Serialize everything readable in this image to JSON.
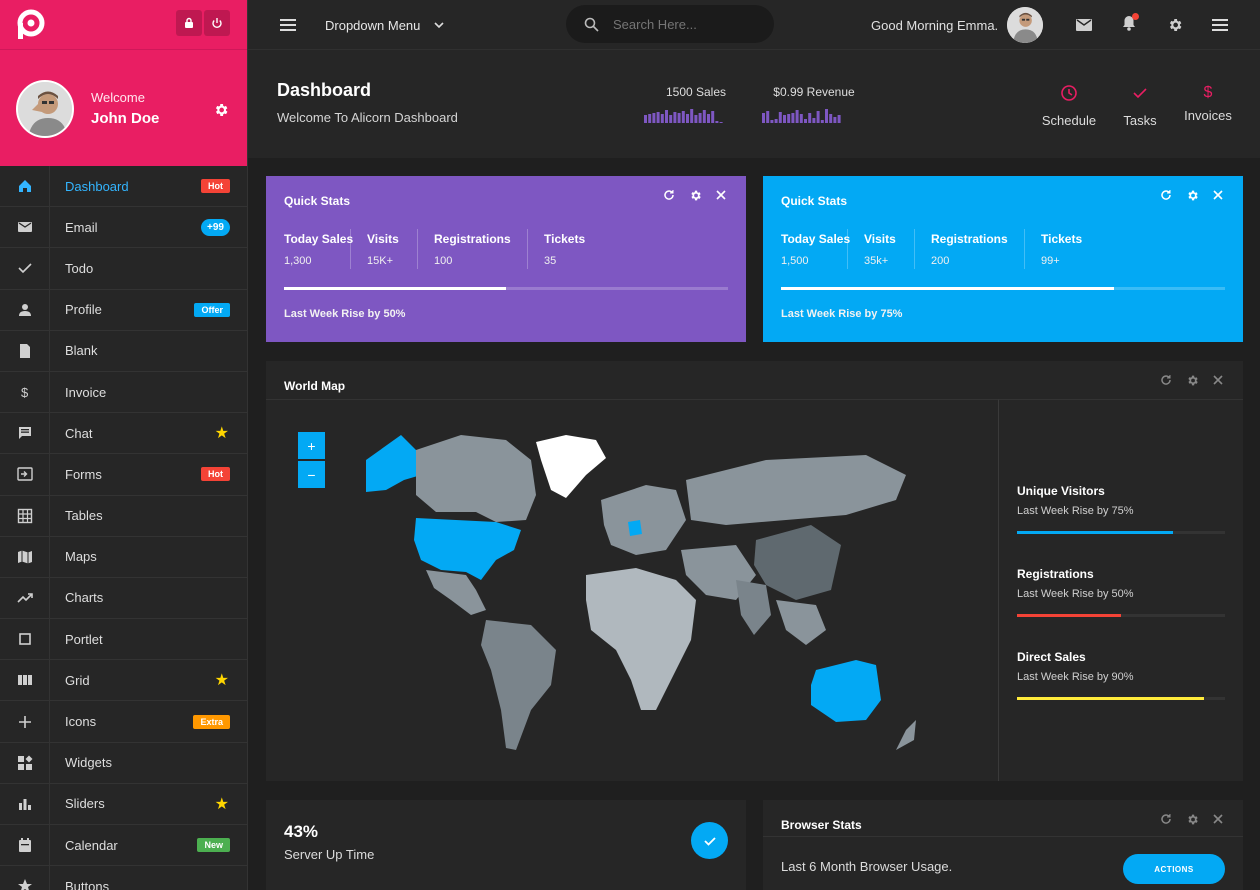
{
  "sidebar": {
    "user": {
      "welcome": "Welcome",
      "name": "John Doe"
    },
    "items": [
      {
        "label": "Dashboard",
        "icon": "home-icon",
        "badge": "Hot",
        "badge_type": "hot",
        "active": true
      },
      {
        "label": "Email",
        "icon": "mail-icon",
        "badge": "+99",
        "badge_type": "num"
      },
      {
        "label": "Todo",
        "icon": "check-icon"
      },
      {
        "label": "Profile",
        "icon": "person-icon",
        "badge": "Offer",
        "badge_type": "offer"
      },
      {
        "label": "Blank",
        "icon": "file-icon"
      },
      {
        "label": "Invoice",
        "icon": "dollar-icon"
      },
      {
        "label": "Chat",
        "icon": "chat-icon",
        "star": true
      },
      {
        "label": "Forms",
        "icon": "input-icon",
        "badge": "Hot",
        "badge_type": "hot"
      },
      {
        "label": "Tables",
        "icon": "grid-icon"
      },
      {
        "label": "Maps",
        "icon": "map-icon"
      },
      {
        "label": "Charts",
        "icon": "trending-icon"
      },
      {
        "label": "Portlet",
        "icon": "square-icon"
      },
      {
        "label": "Grid",
        "icon": "columns-icon",
        "star": true
      },
      {
        "label": "Icons",
        "icon": "plus-icon",
        "badge": "Extra",
        "badge_type": "extra"
      },
      {
        "label": "Widgets",
        "icon": "widgets-icon"
      },
      {
        "label": "Sliders",
        "icon": "bar-chart-icon",
        "star": true
      },
      {
        "label": "Calendar",
        "icon": "calendar-icon",
        "badge": "New",
        "badge_type": "new"
      },
      {
        "label": "Buttons",
        "icon": "star-icon"
      }
    ]
  },
  "topbar": {
    "dropdown_label": "Dropdown Menu",
    "search_placeholder": "Search Here...",
    "greeting": "Good Morning Emma."
  },
  "header": {
    "title": "Dashboard",
    "subtitle": "Welcome To Alicorn Dashboard",
    "sales_label": "1500 Sales",
    "revenue_label": "$0.99 Revenue",
    "actions": [
      {
        "label": "Schedule",
        "icon": "clock-icon"
      },
      {
        "label": "Tasks",
        "icon": "check-icon"
      },
      {
        "label": "Invoices",
        "icon": "dollar-icon"
      }
    ]
  },
  "quick_stats": [
    {
      "title": "Quick Stats",
      "color": "#7e57c2",
      "footer": "Last Week Rise by 50%",
      "progress": 0.5,
      "stats": [
        {
          "k": "Today Sales",
          "v": "1,300"
        },
        {
          "k": "Visits",
          "v": "15K+"
        },
        {
          "k": "Registrations",
          "v": "100"
        },
        {
          "k": "Tickets",
          "v": "35"
        }
      ]
    },
    {
      "title": "Quick Stats",
      "color": "#03a9f4",
      "footer": "Last Week Rise by 75%",
      "progress": 0.75,
      "stats": [
        {
          "k": "Today Sales",
          "v": "1,500"
        },
        {
          "k": "Visits",
          "v": "35k+"
        },
        {
          "k": "Registrations",
          "v": "200"
        },
        {
          "k": "Tickets",
          "v": "99+"
        }
      ]
    }
  ],
  "world_map": {
    "title": "World Map",
    "zoom_in": "+",
    "zoom_out": "−",
    "stats": [
      {
        "k": "Unique Visitors",
        "v": "Last Week Rise by 75%",
        "progress": 0.75,
        "color": "#03a9f4"
      },
      {
        "k": "Registrations",
        "v": "Last Week Rise by 50%",
        "progress": 0.5,
        "color": "#f44336"
      },
      {
        "k": "Direct Sales",
        "v": "Last Week Rise by 90%",
        "progress": 0.9,
        "color": "#ffeb3b"
      }
    ]
  },
  "server": {
    "value": "43%",
    "label": "Server Up Time"
  },
  "browser": {
    "title": "Browser Stats",
    "subtitle": "Last 6 Month Browser Usage.",
    "button": "ACTIONS"
  },
  "colors": {
    "accent": "#e91e63",
    "primary": "#03a9f4",
    "purple": "#7e57c2"
  }
}
